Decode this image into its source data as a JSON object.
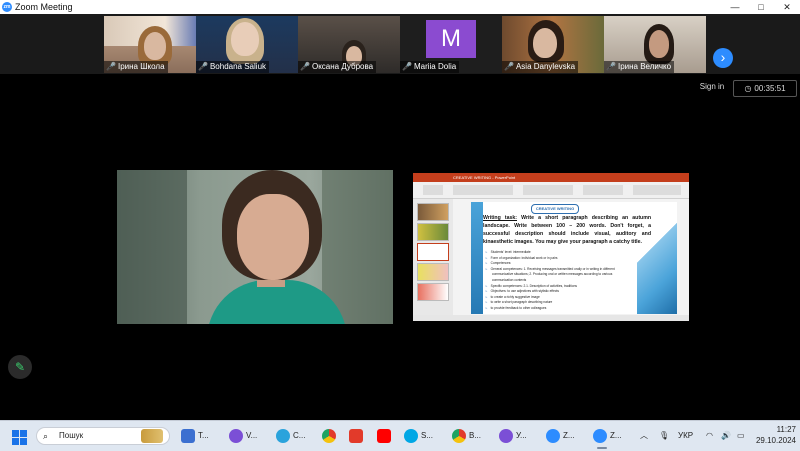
{
  "window": {
    "title": "Zoom Meeting",
    "app_icon": "zoom",
    "controls": {
      "minimize": "—",
      "maximize": "□",
      "close": "✕"
    }
  },
  "gallery": {
    "participants": [
      {
        "name": "Ірина Школа",
        "muted": true
      },
      {
        "name": "Bohdana Saliuk",
        "muted": true
      },
      {
        "name": "Оксана Дуброва",
        "muted": true
      },
      {
        "name": "Mariia Dolia",
        "muted": true,
        "avatar_letter": "M",
        "avatar_color": "#8b4bd0"
      },
      {
        "name": "Asia Danylevska",
        "muted": true
      },
      {
        "name": "Ірина Величко",
        "muted": true
      }
    ],
    "next_icon": "chevron-right-icon"
  },
  "meeting": {
    "signin_label": "Sign in",
    "elapsed": "00:35:51"
  },
  "slide": {
    "app_title": "CREATIVE WRITING - PowerPoint",
    "badge": "CREATIVE WRITING",
    "task_lead": "Writing task:",
    "task_text": " Write a short paragraph describing an autumn landscape. Write between 100 – 200 words. Don't forget, a successful description should include visual, auditory and kinaesthetic images. You may give your paragraph a catchy title.",
    "bullets": [
      "Students' level: intermediate",
      "Form of organization: individual work or in pairs",
      "Competences:",
      "General competences: 1. Receiving messages transmitted orally or in writing in different",
      "communicative situations; 2. Producing oral or written messages according to various",
      "communication contexts",
      "Specific competences: 2.1. Description of activities, traditions",
      "Objectives: to use adjectives with stylistic effects",
      "to create a richly suggestive image",
      "to write a short paragraph describing nature",
      "to provide feedback to other colleagues"
    ]
  },
  "taskbar": {
    "search_placeholder": "Пошук",
    "apps": [
      {
        "label": "T...",
        "color": "#3b6fd0"
      },
      {
        "label": "V...",
        "color": "#7b4fd6"
      },
      {
        "label": "C...",
        "color": "#2aa3dc"
      },
      {
        "label": "",
        "color": "#e8a21a"
      },
      {
        "label": "",
        "color": "#e23a2a"
      },
      {
        "label": "",
        "color": "#ff0000"
      },
      {
        "label": "S...",
        "color": "#00a7e5"
      },
      {
        "label": "B...",
        "color": "#e8a21a"
      },
      {
        "label": "У...",
        "color": "#7b4fd6"
      },
      {
        "label": "Z...",
        "color": "#2d8cff"
      },
      {
        "label": "Z...",
        "color": "#2d8cff"
      }
    ],
    "language": "УКР",
    "time": "11:27",
    "date": "29.10.2024"
  },
  "colors": {
    "zoom_blue": "#2d8cff",
    "muted_red": "#e03b3b",
    "ppt_red": "#c43e1c",
    "edit_green": "#3ccf6e"
  }
}
